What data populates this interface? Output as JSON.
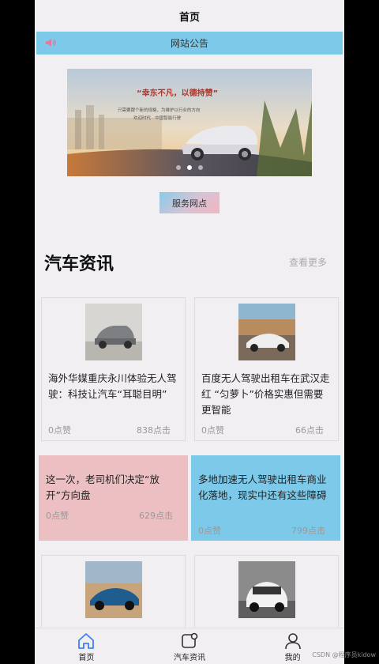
{
  "header": {
    "title": "首页"
  },
  "notice": {
    "label": "网站公告",
    "icon": "speaker-icon"
  },
  "banner": {
    "slogan": "“幸东不凡，以德持赞”",
    "subtext_1": "只需要跟个新的规格，为维护以行业的方向",
    "subtext_2": "欢迎时代 · 中国智能行驶",
    "dot_count": 3,
    "active_dot": 1
  },
  "service_button": "服务网点",
  "section": {
    "title": "汽车资讯",
    "more": "查看更多"
  },
  "articles": [
    {
      "title": "海外华媒重庆永川体验无人驾驶：科技让汽车“耳聪目明”",
      "likes": "0点赞",
      "clicks": "838点击",
      "image": "gray-suv-photo",
      "bg": "#f1eff2"
    },
    {
      "title": "百度无人驾驶出租车在武汉走红 “匀萝卜”价格实惠但需要更智能",
      "likes": "0点赞",
      "clicks": "66点击",
      "image": "white-sports-car-photo",
      "bg": "#f1eff2"
    },
    {
      "title": "这一次，老司机们决定“放开”方向盘",
      "likes": "0点赞",
      "clicks": "629点击",
      "image": "",
      "bg": "#ecc0c3"
    },
    {
      "title": "多地加速无人驾驶出租车商业化落地，现实中还有这些障碍",
      "likes": "0点赞",
      "clicks": "799点击",
      "image": "",
      "bg": "#7dc9ea"
    },
    {
      "title": "",
      "likes": "",
      "clicks": "",
      "image": "blue-sports-car-photo",
      "bg": "#f1eff2"
    },
    {
      "title": "",
      "likes": "",
      "clicks": "",
      "image": "white-suv-photo",
      "bg": "#f1eff2"
    }
  ],
  "tabbar": {
    "items": [
      {
        "label": "首页",
        "icon": "home-icon",
        "active": true,
        "color": "#3b82f6"
      },
      {
        "label": "汽车资讯",
        "icon": "news-icon",
        "active": false
      },
      {
        "label": "我的",
        "icon": "user-icon",
        "active": false
      }
    ]
  },
  "watermark": "CSDN @程序员kidow",
  "colors": {
    "accent_blue": "#7dc9ea",
    "accent_pink": "#ecc0c3",
    "background": "#f1eff2"
  }
}
